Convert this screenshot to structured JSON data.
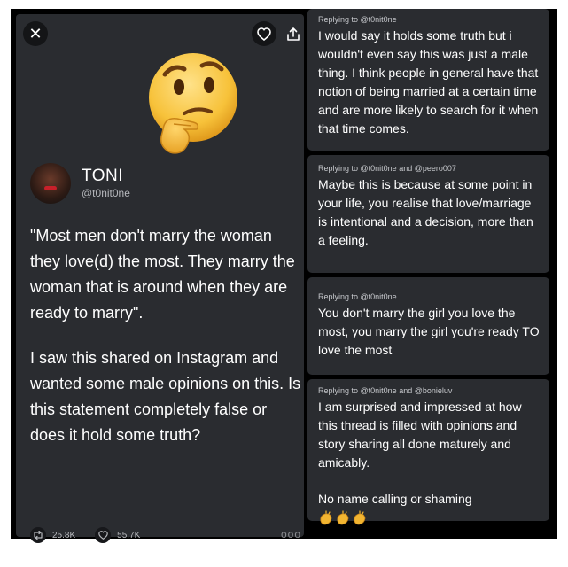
{
  "tweet": {
    "close_label": "✕",
    "author_name": "TONI",
    "author_handle": "@t0nit0ne",
    "emoji": "thinking-face-emoji",
    "paragraphs": [
      "\"Most men don't marry the woman they love(d) the most. They marry the woman that is around when they are ready to marry\".",
      "I saw this shared on Instagram and wanted some male opinions on this. Is this statement completely false or does it hold some truth?"
    ],
    "retweets": "25.8K",
    "likes": "55.7K",
    "more": "ooo"
  },
  "replies": [
    {
      "meta": "Replying to @t0nit0ne",
      "paragraphs": [
        "I would say it holds some truth but i wouldn't even say this was just a male thing. I think people in general have that notion of being married at a certain time and are more likely to search for it when that time comes."
      ]
    },
    {
      "meta": "Replying to @t0nit0ne and @peero007",
      "paragraphs": [
        "Maybe this is because at some point in your life, you realise that love/marriage is intentional and a decision, more than a feeling."
      ]
    },
    {
      "meta": "Replying to @t0nit0ne",
      "paragraphs": [
        "You don't marry the girl you love the most, you marry the girl you're ready TO love the most"
      ]
    },
    {
      "meta": "Replying to @t0nit0ne and @bonieluv",
      "paragraphs": [
        "I am surprised and impressed at how this thread is filled with opinions and story sharing all done maturely and amicably.",
        "No name calling or shaming"
      ],
      "emoji": "clapping-hands-emoji"
    }
  ],
  "colors": {
    "card_bg": "#2a2c30",
    "frame_bg": "#000000",
    "muted_text": "#b6b8bc"
  }
}
